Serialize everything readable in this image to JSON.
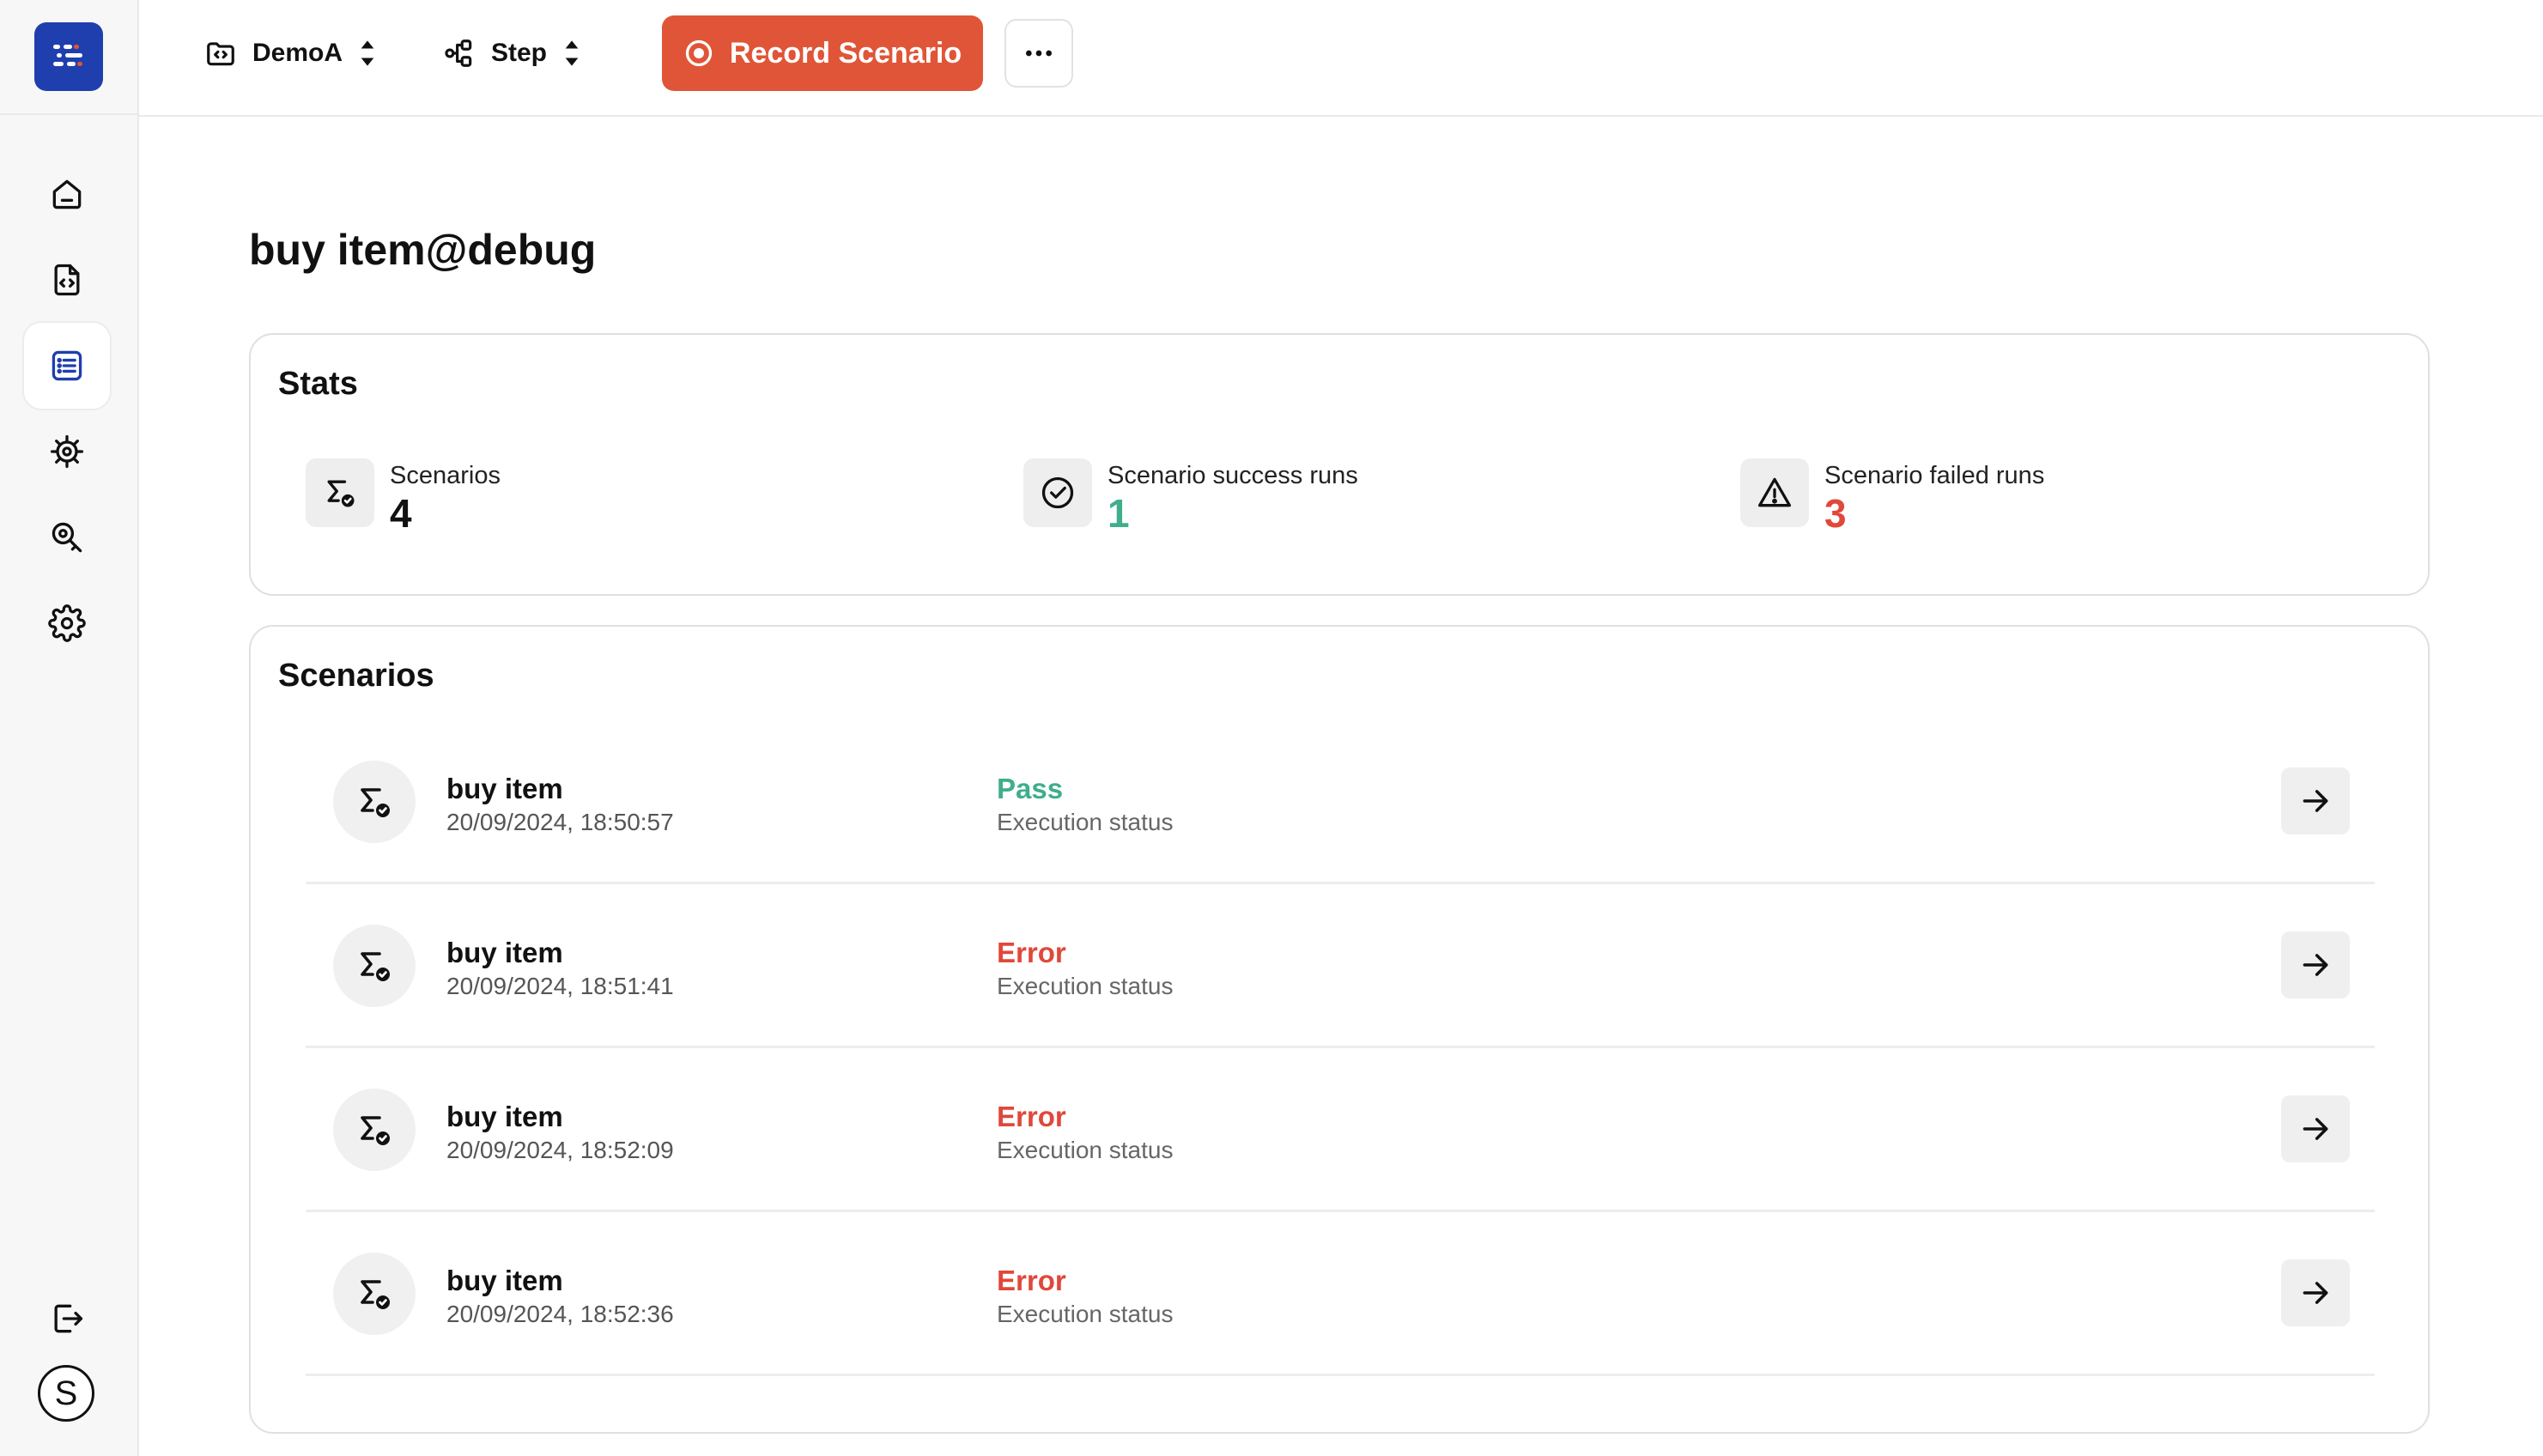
{
  "header": {
    "project_selector": "DemoA",
    "mode_selector": "Step",
    "record_button": "Record Scenario"
  },
  "sidebar": {
    "items": [
      {
        "name": "home"
      },
      {
        "name": "file-code"
      },
      {
        "name": "list",
        "active": true
      },
      {
        "name": "bug"
      },
      {
        "name": "search-key"
      },
      {
        "name": "settings"
      }
    ],
    "avatar_letter": "S"
  },
  "page": {
    "title": "buy item@debug"
  },
  "stats": {
    "title": "Stats",
    "items": [
      {
        "label": "Scenarios",
        "value": "4",
        "color": "#111111"
      },
      {
        "label": "Scenario success runs",
        "value": "1",
        "color": "#3fae8c"
      },
      {
        "label": "Scenario failed runs",
        "value": "3",
        "color": "#e0483a"
      }
    ]
  },
  "scenarios": {
    "title": "Scenarios",
    "rows": [
      {
        "name": "buy item",
        "date": "20/09/2024, 18:50:57",
        "status": "Pass",
        "status_label": "Execution status",
        "status_color": "#3fae8c"
      },
      {
        "name": "buy item",
        "date": "20/09/2024, 18:51:41",
        "status": "Error",
        "status_label": "Execution status",
        "status_color": "#e0483a"
      },
      {
        "name": "buy item",
        "date": "20/09/2024, 18:52:09",
        "status": "Error",
        "status_label": "Execution status",
        "status_color": "#e0483a"
      },
      {
        "name": "buy item",
        "date": "20/09/2024, 18:52:36",
        "status": "Error",
        "status_label": "Execution status",
        "status_color": "#e0483a"
      }
    ]
  },
  "colors": {
    "brand": "#1f3fae",
    "record": "#e05537",
    "pass": "#3fae8c",
    "error": "#e0483a"
  }
}
